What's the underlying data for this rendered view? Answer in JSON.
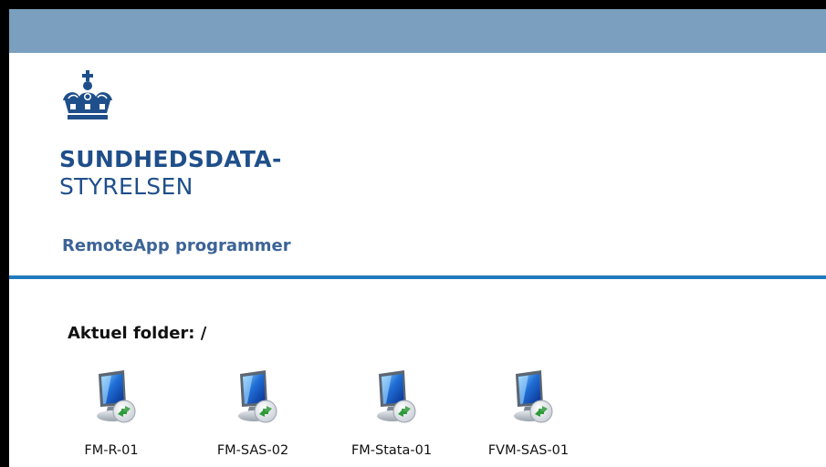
{
  "brand": {
    "line1": "SUNDHEDSDATA-",
    "line2": "STYRELSEN",
    "logo_icon": "royal-crown-icon",
    "color": "#1f4f8a"
  },
  "header": {
    "bar_color": "#7a9fbf",
    "section_title": "RemoteApp programmer"
  },
  "folder": {
    "label": "Aktuel folder: /"
  },
  "apps": [
    {
      "label": "FM-R-01",
      "icon": "remoteapp-computer-icon"
    },
    {
      "label": "FM-SAS-02",
      "icon": "remoteapp-computer-icon"
    },
    {
      "label": "FM-Stata-01",
      "icon": "remoteapp-computer-icon"
    },
    {
      "label": "FVM-SAS-01",
      "icon": "remoteapp-computer-icon"
    }
  ],
  "colors": {
    "accent_line": "#1f7ac0",
    "section_title": "#3b6497"
  }
}
